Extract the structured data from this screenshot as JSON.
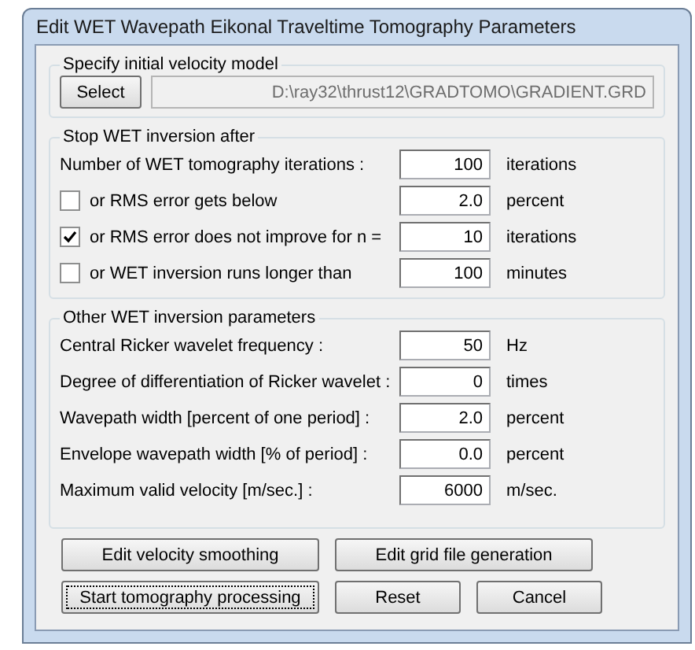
{
  "window": {
    "title": "Edit WET Wavepath Eikonal Traveltime Tomography Parameters"
  },
  "velocity_model": {
    "legend": "Specify initial velocity model",
    "button": "Select",
    "path": "D:\\ray32\\thrust12\\GRADTOMO\\GRADIENT.GRD"
  },
  "stop_group": {
    "legend": "Stop WET inversion after",
    "rows": [
      {
        "kind": "plain",
        "label": "Number of WET tomography iterations :",
        "value": "100",
        "unit": "iterations"
      },
      {
        "kind": "check",
        "checked": false,
        "label": "or RMS error gets below",
        "value": "2.0",
        "unit": "percent"
      },
      {
        "kind": "check",
        "checked": true,
        "label": "or RMS error does not improve for n =",
        "value": "10",
        "unit": "iterations"
      },
      {
        "kind": "check",
        "checked": false,
        "label": "or WET inversion runs longer than",
        "value": "100",
        "unit": "minutes"
      }
    ]
  },
  "other_group": {
    "legend": "Other WET inversion parameters",
    "rows": [
      {
        "label": "Central Ricker wavelet frequency :",
        "value": "50",
        "unit": "Hz"
      },
      {
        "label": "Degree of differentiation of Ricker wavelet :",
        "value": "0",
        "unit": "times"
      },
      {
        "label": "Wavepath width [percent of one period] :",
        "value": "2.0",
        "unit": "percent"
      },
      {
        "label": "Envelope wavepath width [% of period] :",
        "value": "0.0",
        "unit": "percent"
      },
      {
        "label": "Maximum valid velocity [m/sec.] :",
        "value": "6000",
        "unit": "m/sec."
      }
    ]
  },
  "buttons": [
    [
      {
        "label": "Edit velocity smoothing",
        "focused": false
      },
      {
        "label": "Edit grid file generation",
        "focused": false
      }
    ],
    [
      {
        "label": "Start tomography processing",
        "focused": true
      },
      {
        "label": "Reset",
        "focused": false
      },
      {
        "label": "Cancel",
        "focused": false
      }
    ]
  ]
}
